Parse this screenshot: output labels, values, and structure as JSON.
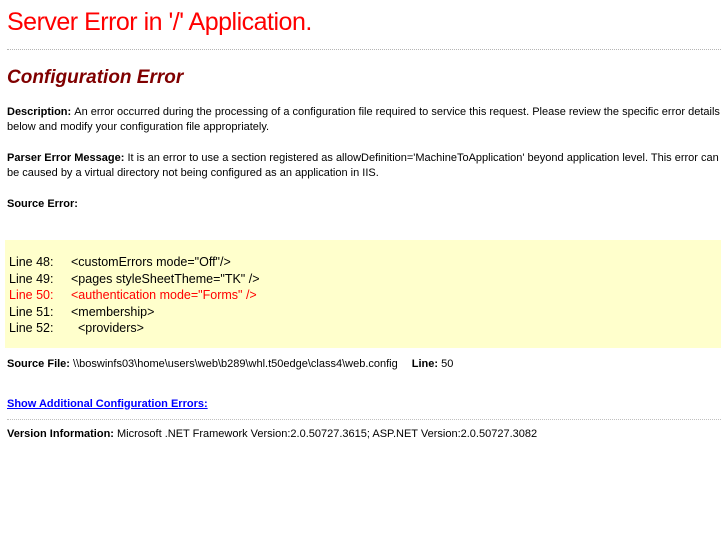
{
  "page": {
    "title": "Server Error in '/' Application.",
    "heading": "Configuration Error"
  },
  "description": {
    "label": "Description: ",
    "text": "An error occurred during the processing of a configuration file required to service this request. Please review the specific error details below and modify your configuration file appropriately."
  },
  "parser_error": {
    "label": "Parser Error Message: ",
    "text": "It is an error to use a section registered as allowDefinition='MachineToApplication' beyond application level.  This error can be caused by a virtual directory not being configured as an application in IIS."
  },
  "source_error": {
    "label": "Source Error:",
    "lines": [
      {
        "no": "Line 48:",
        "code": "<customErrors mode=\"Off\"/>"
      },
      {
        "no": "Line 49:",
        "code": "<pages styleSheetTheme=\"TK\" />"
      },
      {
        "no": "Line 50:",
        "code": "<authentication mode=\"Forms\" />"
      },
      {
        "no": "Line 51:",
        "code": "<membership>"
      },
      {
        "no": "Line 52:",
        "code": "  <providers>"
      }
    ],
    "highlighted_line": "Line 50"
  },
  "source_file": {
    "label": "Source File: ",
    "path": "\\\\boswinfs03\\home\\users\\web\\b289\\whl.t50edge\\class4\\web.config",
    "line_label": "Line: ",
    "line_number": "50"
  },
  "additional_errors_link": {
    "text": "Show Additional Configuration Errors:"
  },
  "version": {
    "label": "Version Information: ",
    "text": "Microsoft .NET Framework Version:2.0.50727.3615; ASP.NET Version:2.0.50727.3082"
  },
  "colors": {
    "title_red": "#ff0000",
    "heading_maroon": "#800000",
    "highlight_red": "#ff0000",
    "code_background": "#ffffcc",
    "link_blue": "#0000ff",
    "rule_silver": "#b5b5b5"
  }
}
